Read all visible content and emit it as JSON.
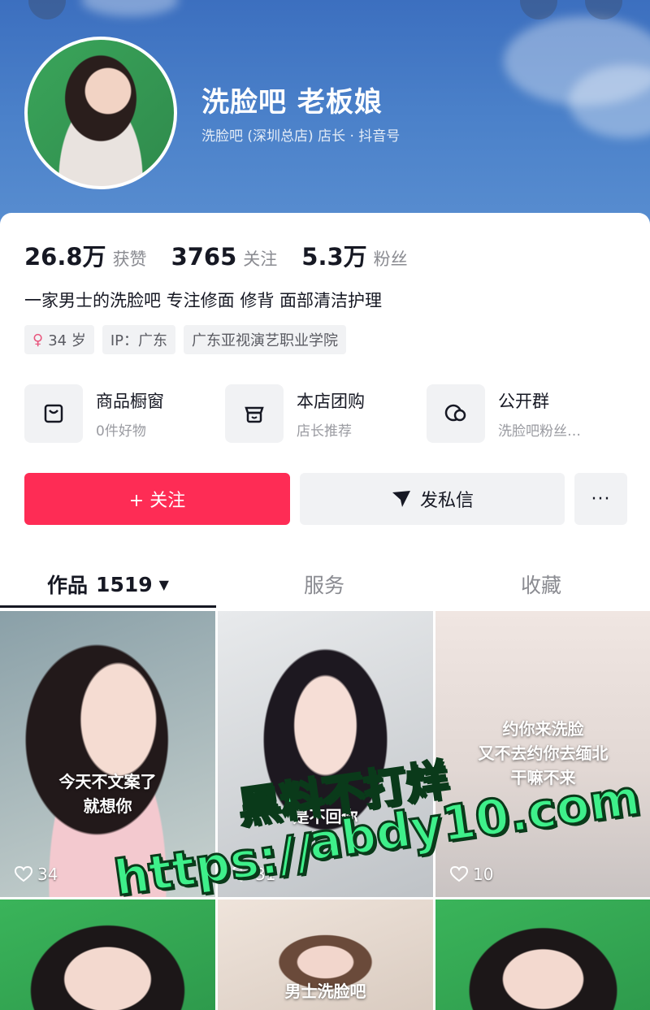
{
  "profile": {
    "name": "洗脸吧 老板娘",
    "subtitle": "洗脸吧 (深圳总店) 店长 · 抖音号"
  },
  "stats": [
    {
      "value": "26.8万",
      "label": "获赞"
    },
    {
      "value": "3765",
      "label": "关注"
    },
    {
      "value": "5.3万",
      "label": "粉丝"
    }
  ],
  "bio": "一家男士的洗脸吧 专注修面 修背 面部清洁护理",
  "tags": {
    "age": "34 岁",
    "ip": "IP：广东",
    "school": "广东亚视演艺职业学院"
  },
  "shortcuts": [
    {
      "title": "商品橱窗",
      "sub": "0件好物",
      "icon": "bag-icon"
    },
    {
      "title": "本店团购",
      "sub": "店长推荐",
      "icon": "store-icon"
    },
    {
      "title": "公开群",
      "sub": "洗脸吧粉丝…",
      "icon": "chat-icon"
    }
  ],
  "actions": {
    "follow": "+ 关注",
    "message": "发私信",
    "more": "···"
  },
  "tabs": {
    "works": "作品",
    "works_count": "1519",
    "service": "服务",
    "favorites": "收藏"
  },
  "videos": [
    {
      "caption_line1": "今天不文案了",
      "caption_line2": "就想你",
      "likes": "34"
    },
    {
      "caption_line1": "",
      "caption_line2": "是不回你",
      "likes": "31"
    },
    {
      "caption_line1": "约你来洗脸",
      "caption_line2": "又不去约你去缅北",
      "caption_line3": "干嘛不来",
      "likes": "10"
    },
    {
      "caption_line1": "",
      "caption_line2": "",
      "likes": ""
    },
    {
      "caption_line1": "男士洗脸吧",
      "caption_line2": "",
      "likes": ""
    },
    {
      "caption_line1": "",
      "caption_line2": "",
      "likes": ""
    }
  ],
  "watermark": {
    "line1": "黑料不打烊",
    "line2": "abdy10.com",
    "line3": "https://"
  },
  "colors": {
    "accent": "#fe2c55",
    "header": "#4a80c9",
    "watermark": "#3ef08a"
  }
}
